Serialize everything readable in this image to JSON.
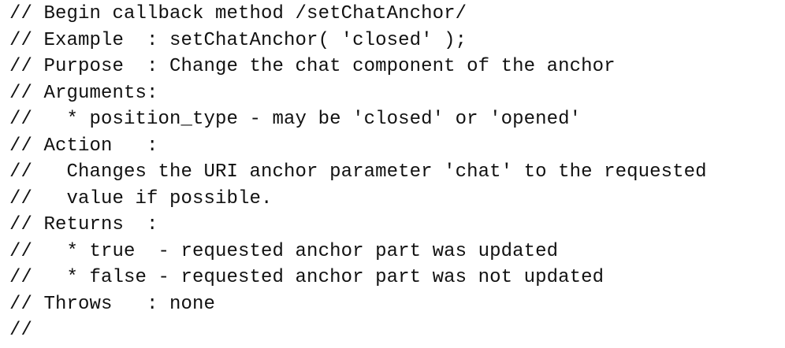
{
  "code": {
    "lines": [
      "// Begin callback method /setChatAnchor/",
      "// Example  : setChatAnchor( 'closed' );",
      "// Purpose  : Change the chat component of the anchor",
      "// Arguments:",
      "//   * position_type - may be 'closed' or 'opened'",
      "// Action   :",
      "//   Changes the URI anchor parameter 'chat' to the requested",
      "//   value if possible.",
      "// Returns  :",
      "//   * true  - requested anchor part was updated",
      "//   * false - requested anchor part was not updated",
      "// Throws   : none",
      "//"
    ]
  },
  "colors": {
    "text": "#111111",
    "background": "#ffffff"
  }
}
